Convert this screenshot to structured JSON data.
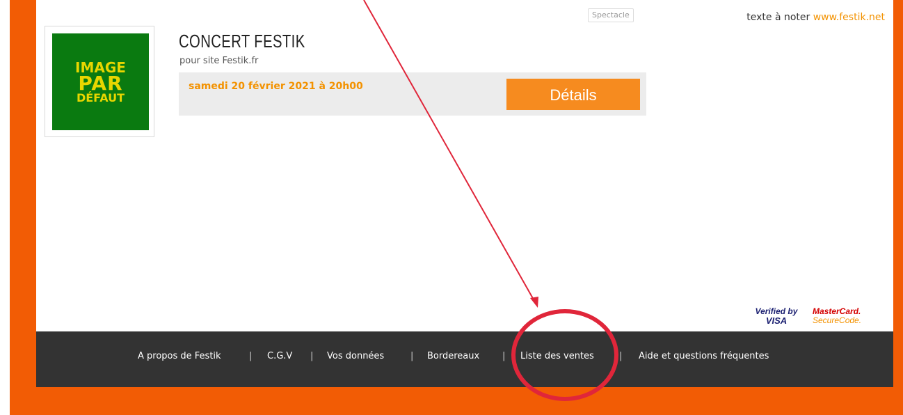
{
  "category_tag": "Spectacle",
  "top_note": {
    "text": "texte à noter",
    "link": "www.festik.net"
  },
  "thumbnail": {
    "line1": "IMAGE",
    "line2": "PAR",
    "line3": "DÉFAUT"
  },
  "event": {
    "title": "CONCERT FESTIK",
    "subtitle": "pour site Festik.fr",
    "date": "samedi 20 février 2021 à 20h00",
    "details_label": "Détails"
  },
  "payment": {
    "visa_line1": "Verified by",
    "visa_line2": "VISA",
    "mc_line1": "MasterCard.",
    "mc_line2": "SecureCode."
  },
  "footer": {
    "links": [
      "A propos de Festik",
      "C.G.V",
      "Vos données",
      "Bordereaux",
      "Liste des ventes",
      "Aide et questions fréquentes"
    ],
    "separator": "|"
  },
  "colors": {
    "frame": "#f25c05",
    "accent": "#f39200",
    "button": "#f68b1f",
    "footer": "#333333",
    "annotation": "#e0263a"
  }
}
